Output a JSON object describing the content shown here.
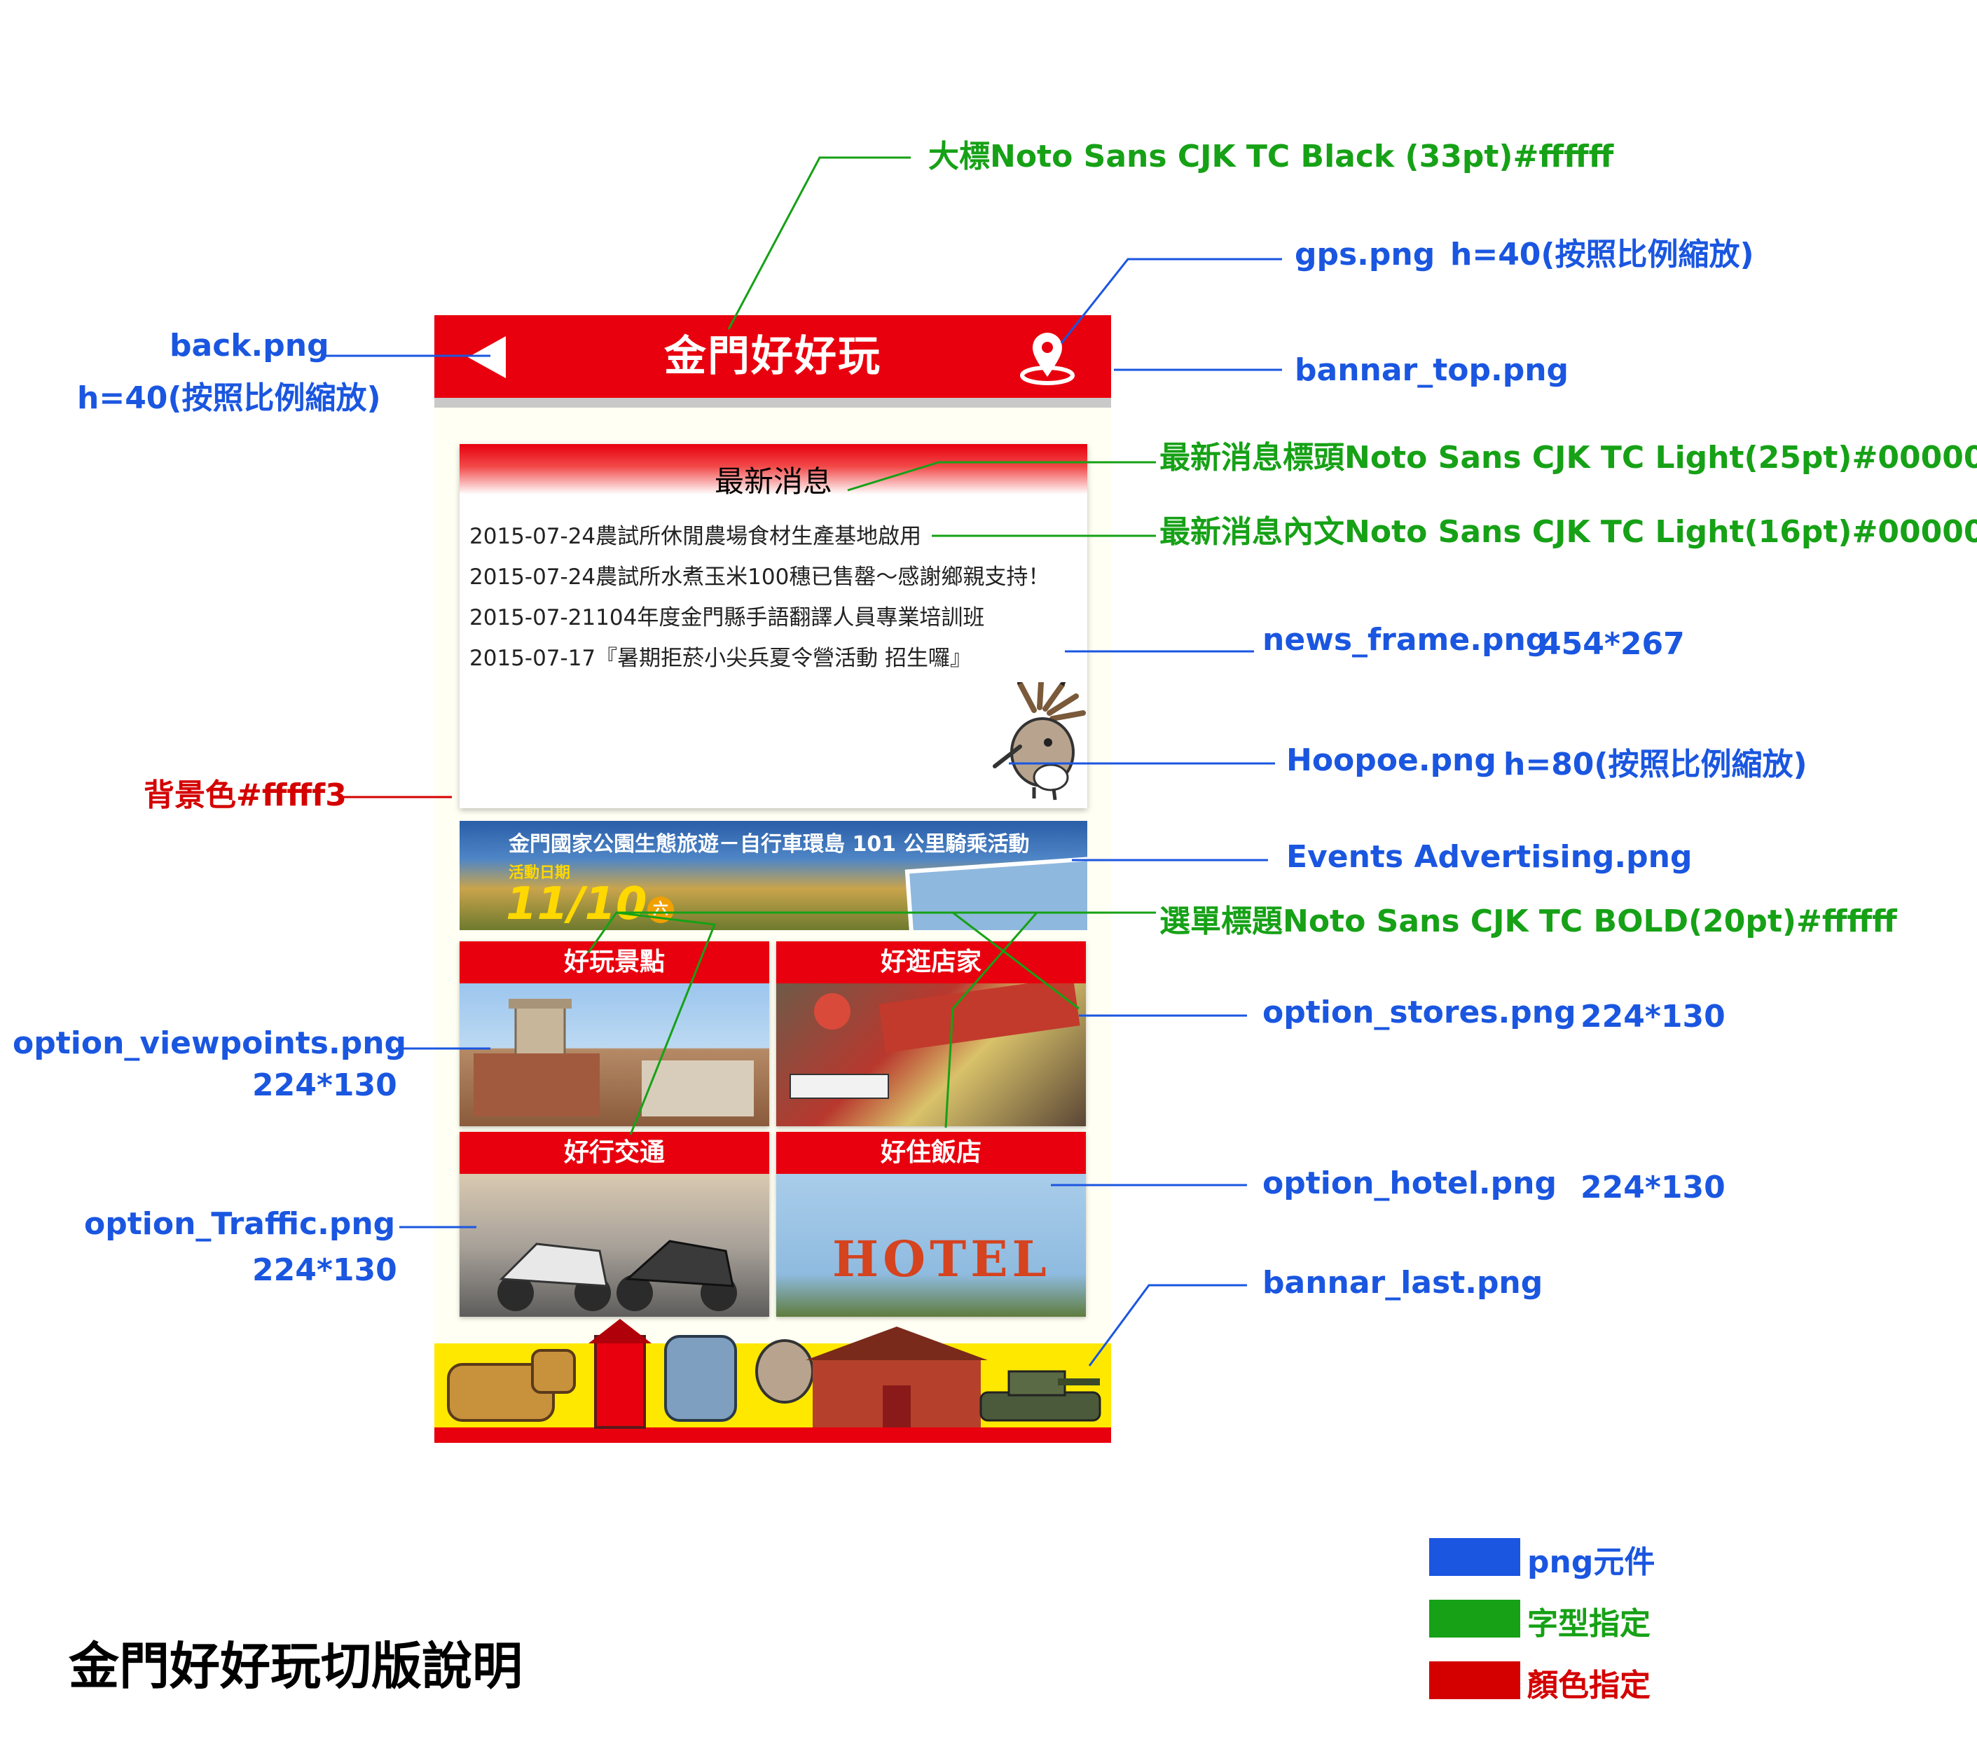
{
  "app": {
    "title": "金門好好玩",
    "news": {
      "title": "最新消息",
      "items": [
        "2015-07-24農試所休閒農場食材生產基地啟用",
        "2015-07-24農試所水煮玉米100穗已售罄～感謝鄉親支持！",
        "2015-07-21104年度金門縣手語翻譯人員專業培訓班",
        "2015-07-17『暑期拒菸小尖兵夏令營活動 招生囉』"
      ]
    },
    "events": {
      "title": "金門國家公園生態旅遊－自行車環島 101 公里騎乘活動",
      "date_label": "活動日期",
      "date": "11/10",
      "day": "六"
    },
    "options": {
      "viewpoints": "好玩景點",
      "stores": "好逛店家",
      "traffic": "好行交通",
      "hotel": "好住飯店",
      "hotel_sign": "HOTEL"
    },
    "icons": {
      "back": "back-arrow-icon",
      "gps": "map-pin-icon"
    }
  },
  "annotations": {
    "title_font": "大標Noto Sans CJK TC Black (33pt)#ffffff",
    "gps": "gps.png",
    "gps_size": "h=40(按照比例縮放)",
    "back": "back.png",
    "back_size": "h=40(按照比例縮放)",
    "bannar_top": "bannar_top.png",
    "news_title_font": "最新消息標頭Noto Sans CJK TC Light(25pt)#000000",
    "news_body_font": "最新消息內文Noto Sans CJK TC Light(16pt)#000000",
    "news_frame": "news_frame.png",
    "news_frame_size": "454*267",
    "hoopoe": "Hoopoe.png",
    "hoopoe_size": "h=80(按照比例縮放)",
    "bg_color": "背景色#fffff3",
    "events_ad": "Events Advertising.png",
    "menu_title_font": "選單標題Noto Sans CJK TC BOLD(20pt)#ffffff",
    "opt_viewpoints": "option_viewpoints.png",
    "opt_viewpoints_size": "224*130",
    "opt_stores": "option_stores.png",
    "opt_stores_size": "224*130",
    "opt_traffic": "option_Traffic.png",
    "opt_traffic_size": "224*130",
    "opt_hotel": "option_hotel.png",
    "opt_hotel_size": "224*130",
    "bannar_last": "bannar_last.png"
  },
  "legend": {
    "png": "png元件",
    "font": "字型指定",
    "color": "顏色指定"
  },
  "colors": {
    "png": "#1a56e0",
    "font": "#16a116",
    "color": "#d40000",
    "brand_red": "#e8000e",
    "background": "#fffff3"
  },
  "caption": "金門好好玩切版說明"
}
